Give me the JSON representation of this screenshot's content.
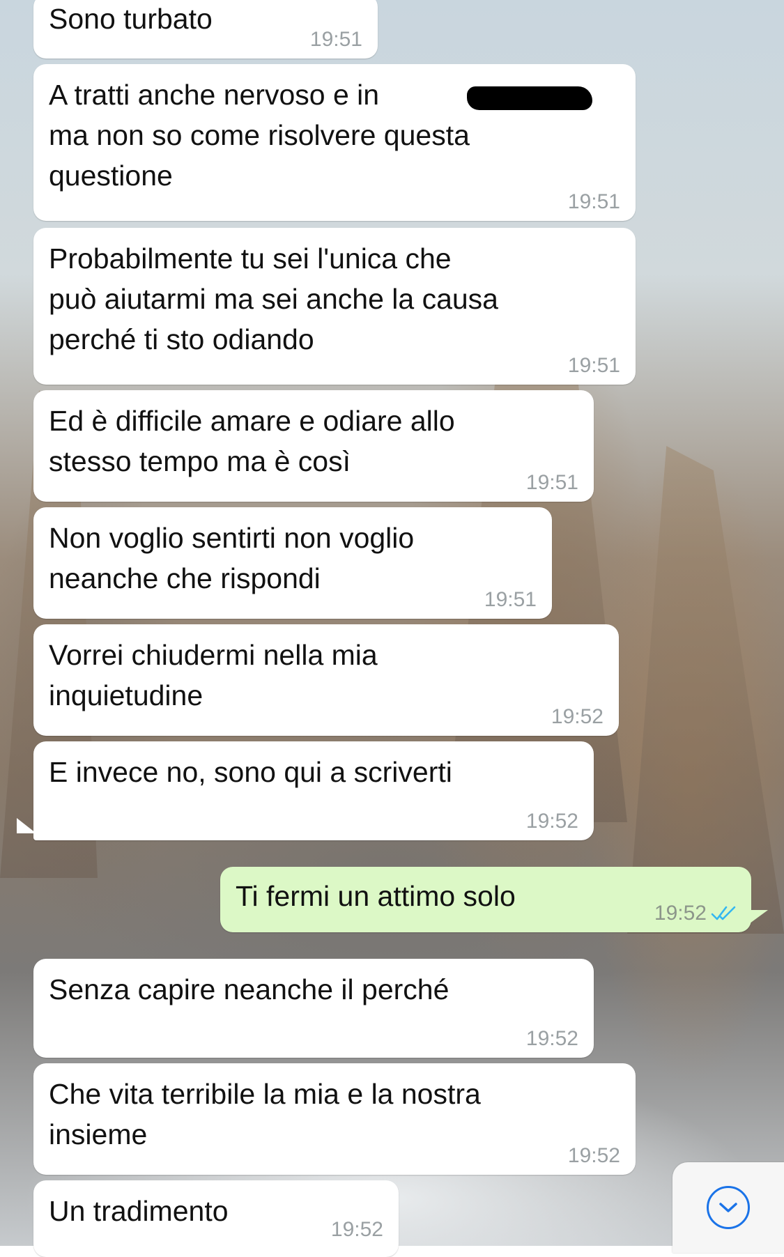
{
  "messages": [
    {
      "text": "Sono turbato",
      "time": "19:51",
      "dir": "in"
    },
    {
      "text": "A tratti anche nervoso e in\nma non so come risolvere questa\nquestione",
      "time": "19:51",
      "dir": "in"
    },
    {
      "text": "Probabilmente tu sei l'unica che\npuò aiutarmi ma sei anche la causa\nperché ti sto odiando",
      "time": "19:51",
      "dir": "in"
    },
    {
      "text": "Ed è difficile amare e odiare allo\nstesso tempo ma è così",
      "time": "19:51",
      "dir": "in"
    },
    {
      "text": "Non voglio sentirti non voglio\nneanche che rispondi",
      "time": "19:51",
      "dir": "in"
    },
    {
      "text": "Vorrei chiudermi nella mia\ninquietudine",
      "time": "19:52",
      "dir": "in"
    },
    {
      "text": "E invece no, sono qui a scriverti",
      "time": "19:52",
      "dir": "in"
    },
    {
      "text": "Ti fermi un attimo solo",
      "time": "19:52",
      "dir": "out",
      "status": "read"
    },
    {
      "text": "Senza capire neanche il perché",
      "time": "19:52",
      "dir": "in"
    },
    {
      "text": "Che vita terribile la mia e la nostra\ninsieme",
      "time": "19:52",
      "dir": "in"
    },
    {
      "text": "Un tradimento",
      "time": "19:52",
      "dir": "in"
    }
  ],
  "colors": {
    "incoming": "#ffffff",
    "outgoing": "#dcf8c6",
    "read_ticks": "#34b7f1",
    "accent": "#1a73e8"
  },
  "scroll_button": {
    "icon": "chevron-down-circle-icon"
  }
}
